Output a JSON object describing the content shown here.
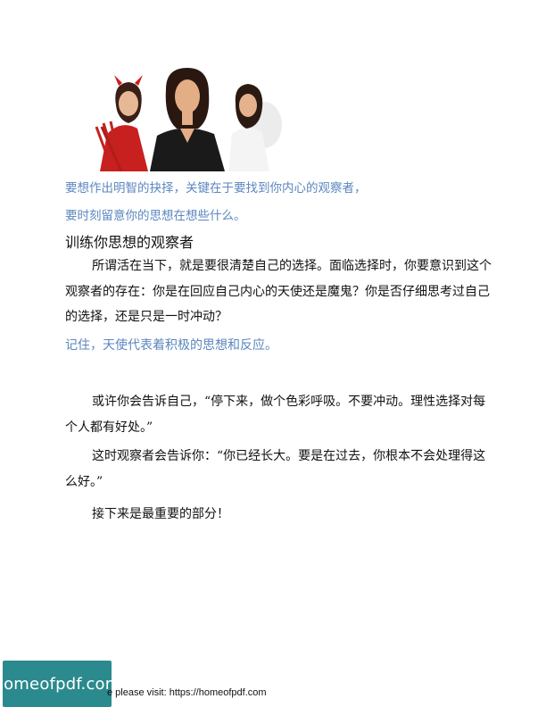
{
  "captions": [
    "要想作出明智的抉择，关键在于要找到你内心的观察者，",
    "要时刻留意你的思想在想些什么。"
  ],
  "heading": "训练你思想的观察者",
  "paragraph1": "所谓活在当下，就是要很清楚自己的选择。面临选择时，你要意识到这个观察者的存在：你是在回应自己内心的天使还是魔鬼？你是否仔细思考过自己的选择，还是只是一时冲动？",
  "highlight": "记住，天使代表着积极的思想和反应。",
  "paragraph2": "或许你会告诉自己，“停下来，做个色彩呼吸。不要冲动。理性选择对每个人都有好处。”",
  "paragraph3": "这时观察者会告诉你：“你已经长大。要是在过去，你根本不会处理得这么好。”",
  "paragraph4": "接下来是最重要的部分！",
  "footer": {
    "logo_text": "homeofpdf.com",
    "visit_text": "e please visit: https://homeofpdf.com"
  },
  "colors": {
    "accent_blue": "#5b86bf",
    "logo_teal": "#2b8a8e"
  }
}
